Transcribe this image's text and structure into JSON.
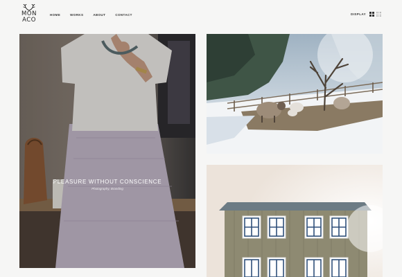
{
  "brand": {
    "line1": "MON",
    "line2": "ACO"
  },
  "nav": {
    "items": [
      "HOME",
      "WORKS",
      "ABOUT",
      "CONTACT"
    ]
  },
  "display": {
    "label": "DISPLAY"
  },
  "works": [
    {
      "title": "PLEASURE WITHOUT CONSCIENCE",
      "categories": "Photography, Branding"
    }
  ],
  "colors": {
    "background": "#f6f6f5",
    "text": "#222222",
    "overlay_text": "#ffffff"
  }
}
